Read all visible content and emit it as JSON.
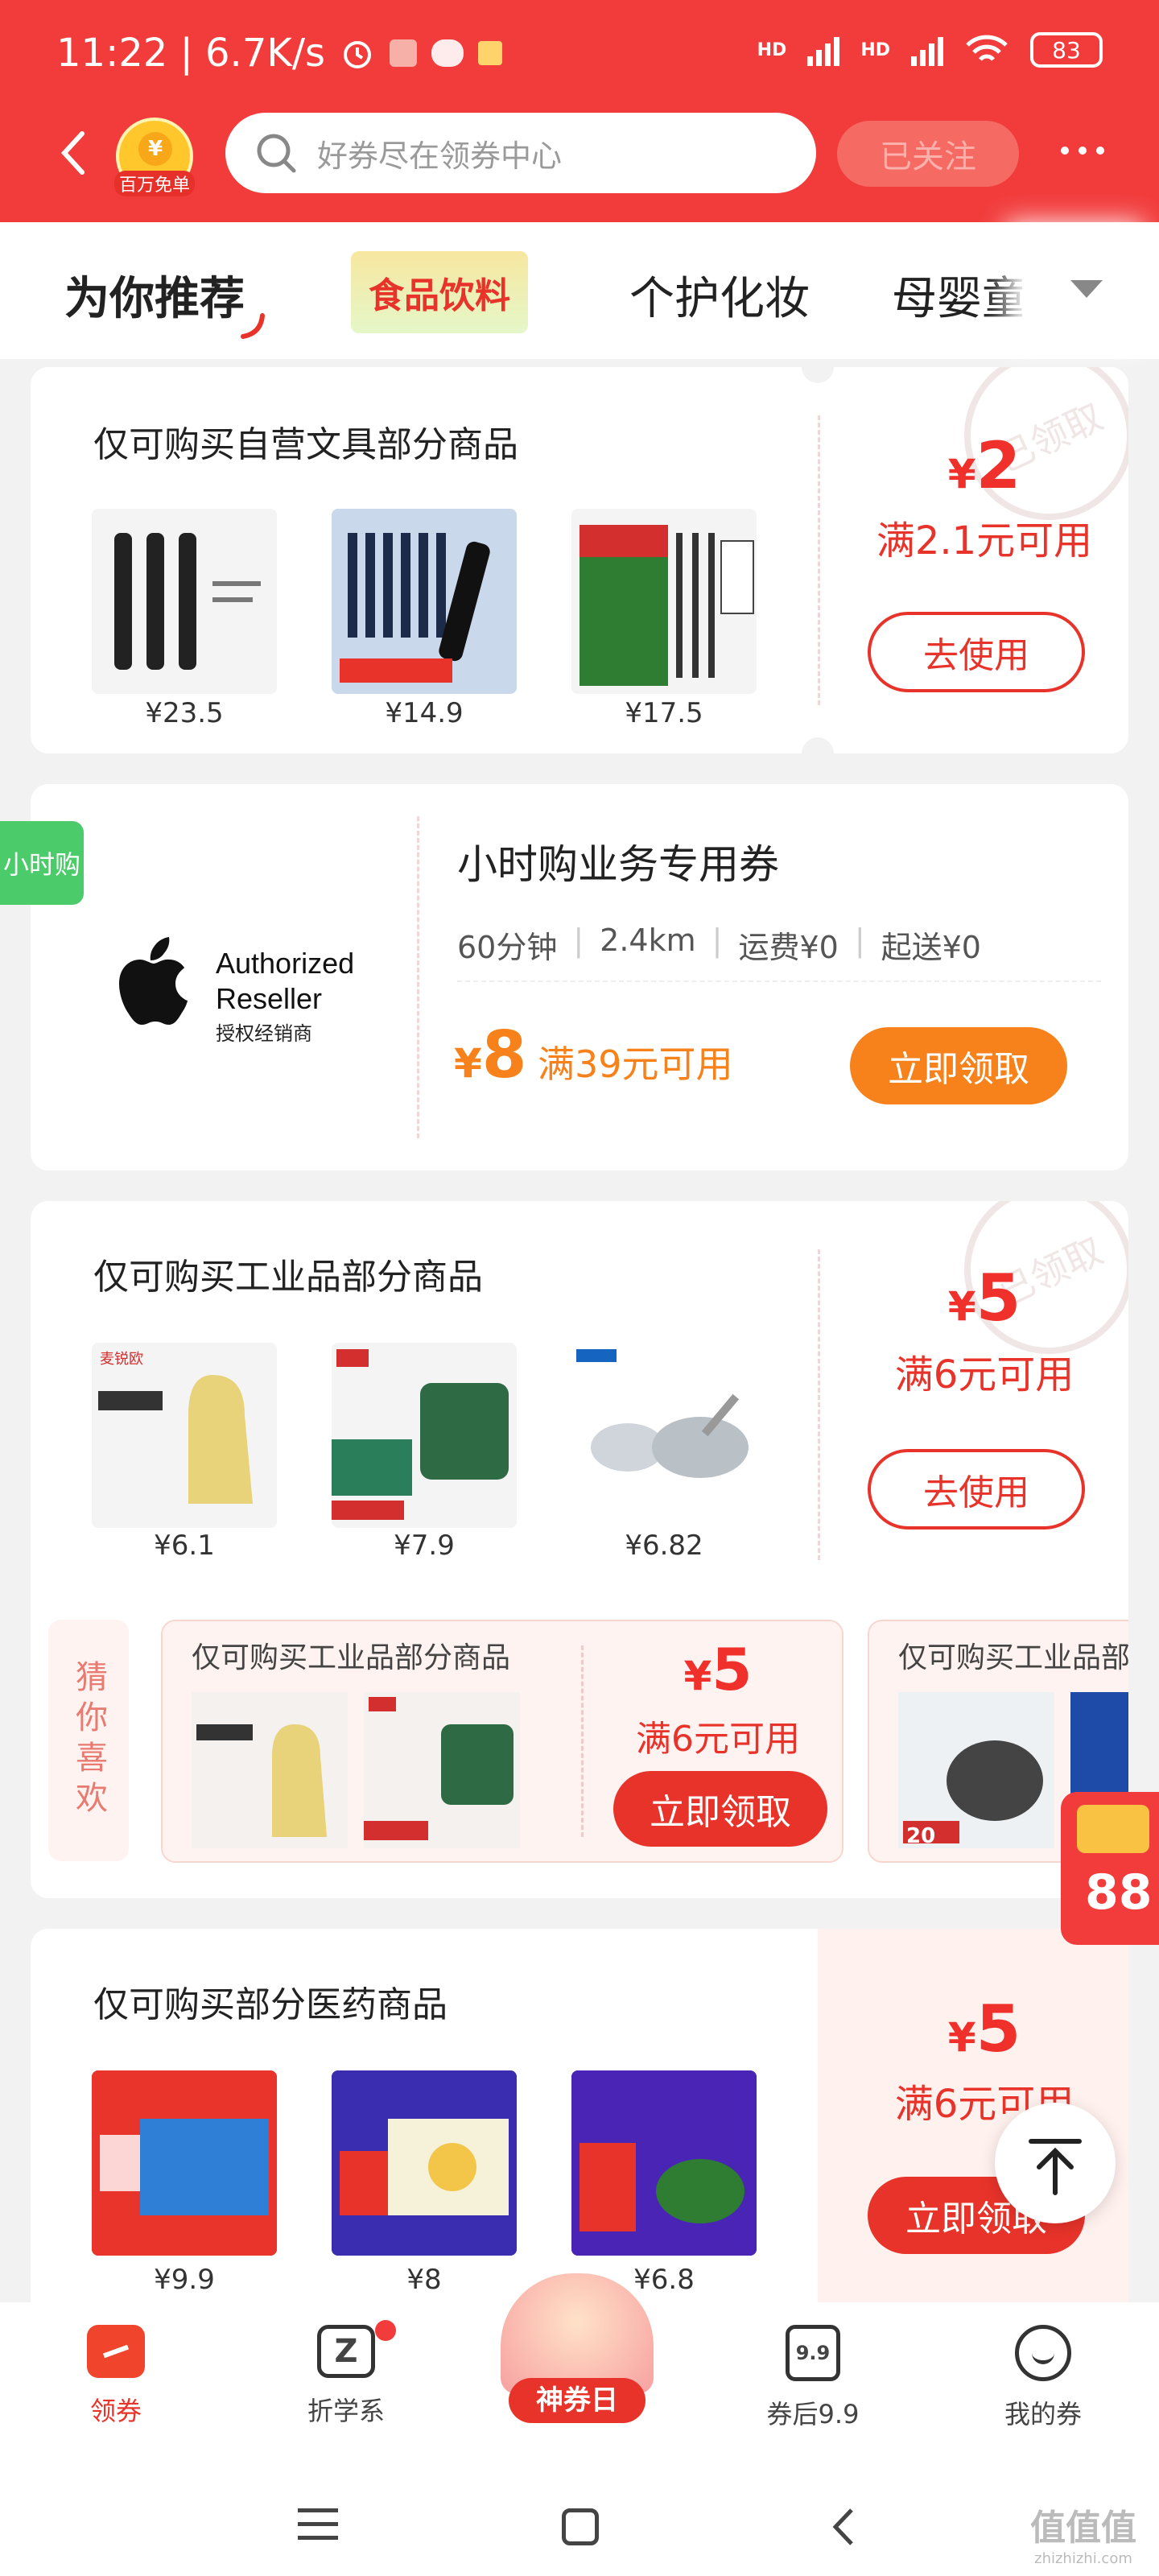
{
  "status_bar": {
    "time": "11:22 | 6.7K/s",
    "battery": "83",
    "hd1": "HD",
    "hd2": "HD"
  },
  "header": {
    "badge_label": "百万免单",
    "badge_symbol": "¥",
    "search_placeholder": "好券尽在领券中心",
    "follow_label": "已关注"
  },
  "tabs": [
    "为你推荐",
    "食品饮料",
    "个护化妆",
    "母婴童"
  ],
  "coupon1": {
    "title": "仅可购买自营文具部分商品",
    "products": [
      {
        "price": "¥23.5",
        "color": "#f4f4f4"
      },
      {
        "price": "¥14.9",
        "color": "#c9d8ea"
      },
      {
        "price": "¥17.5",
        "color": "#2e7d32"
      }
    ],
    "currency": "¥",
    "amount": "2",
    "condition": "满2.1元可用",
    "button": "去使用",
    "stamp": "已领取"
  },
  "hourly": {
    "tag": "小时购",
    "brand_line1": "Authorized",
    "brand_line2": "Reseller",
    "brand_cn": "授权经销商",
    "title": "小时购业务专用券",
    "meta": [
      "60分钟",
      "2.4km",
      "运费¥0",
      "起送¥0"
    ],
    "currency": "¥",
    "amount": "8",
    "condition": "满39元可用",
    "button": "立即领取"
  },
  "coupon2": {
    "title": "仅可购买工业品部分商品",
    "products": [
      {
        "price": "¥6.1",
        "color": "#f1e6b8"
      },
      {
        "price": "¥7.9",
        "color": "#3f8f5a"
      },
      {
        "price": "¥6.82",
        "color": "#e7ebee"
      }
    ],
    "currency": "¥",
    "amount": "5",
    "condition": "满6元可用",
    "button": "去使用",
    "stamp": "已领取"
  },
  "guess": {
    "label": "猜你喜欢",
    "card1": {
      "title": "仅可购买工业品部分商品",
      "currency": "¥",
      "amount": "5",
      "condition": "满6元可用",
      "button": "立即领取"
    },
    "card2": {
      "title": "仅可购买工业品部",
      "tag": "20"
    }
  },
  "coupon3": {
    "title": "仅可购买部分医药商品",
    "products": [
      {
        "price": "¥9.9",
        "color": "#e8342a"
      },
      {
        "price": "¥8",
        "color": "#3a2db0"
      },
      {
        "price": "¥6.8",
        "color": "#4a25b5"
      }
    ],
    "currency": "¥",
    "amount": "5",
    "condition": "满6元可用",
    "button": "立即领取"
  },
  "floating": {
    "number": "88"
  },
  "bottom_tabs": [
    {
      "label": "领券"
    },
    {
      "label": "折学系"
    },
    {
      "label": "神券日"
    },
    {
      "label": "券后9.9",
      "icon_text": "9.9"
    },
    {
      "label": "我的券"
    }
  ],
  "watermark": {
    "line1": "值值值",
    "line2": "zhizhizhi.com"
  },
  "colors": {
    "brand_red": "#f23c3c",
    "accent": "#e8332a",
    "orange": "#f7821b"
  }
}
